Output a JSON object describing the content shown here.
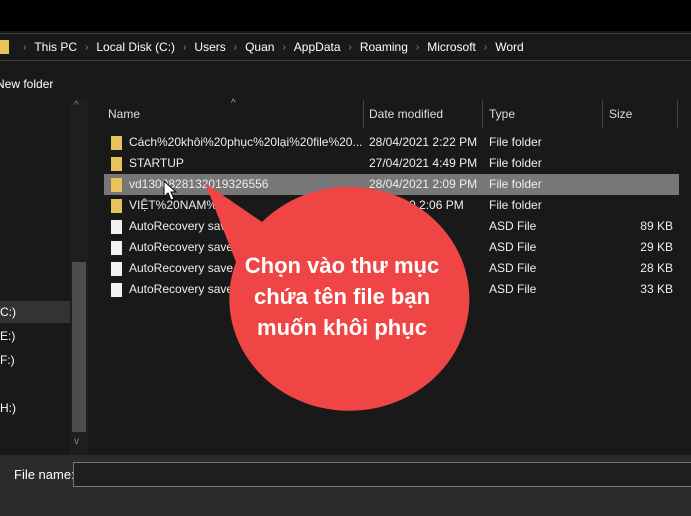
{
  "breadcrumb": [
    "This PC",
    "Local Disk (C:)",
    "Users",
    "Quan",
    "AppData",
    "Roaming",
    "Microsoft",
    "Word"
  ],
  "toolbar": {
    "new_folder": "New folder"
  },
  "nav": {
    "items": [
      "C:)",
      "E:)",
      "F:)",
      "H:)"
    ]
  },
  "columns": {
    "name": "Name",
    "date": "Date modified",
    "type": "Type",
    "size": "Size"
  },
  "files": [
    {
      "name": "Cách%20khôi%20phục%20lại%20file%20...",
      "date": "28/04/2021 2:22 PM",
      "type": "File folder",
      "size": "",
      "kind": "folder"
    },
    {
      "name": "STARTUP",
      "date": "27/04/2021 4:49 PM",
      "type": "File folder",
      "size": "",
      "kind": "folder"
    },
    {
      "name": "vd1300828132019326556",
      "date": "28/04/2021 2:09 PM",
      "type": "File folder",
      "size": "",
      "kind": "folder",
      "selected": true
    },
    {
      "name": "VIỆT%20NAM%",
      "date": "/02/2020 2:06 PM",
      "type": "File folder",
      "size": "",
      "kind": "folder"
    },
    {
      "name": "AutoRecovery save",
      "date": "0 2:59 PM",
      "type": "ASD File",
      "size": "89 KB",
      "kind": "file"
    },
    {
      "name": "AutoRecovery save",
      "date": "3 PM",
      "type": "ASD File",
      "size": "29 KB",
      "kind": "file"
    },
    {
      "name": "AutoRecovery save",
      "date": "PM",
      "type": "ASD File",
      "size": "28 KB",
      "kind": "file"
    },
    {
      "name": "AutoRecovery save",
      "date": "M",
      "type": "ASD File",
      "size": "33 KB",
      "kind": "file"
    }
  ],
  "footer": {
    "file_name_label": "File name:",
    "file_name_value": ""
  },
  "callout": {
    "text": "Chọn vào thư mục chứa tên file bạn muốn khôi phục",
    "color": "#f04545"
  }
}
